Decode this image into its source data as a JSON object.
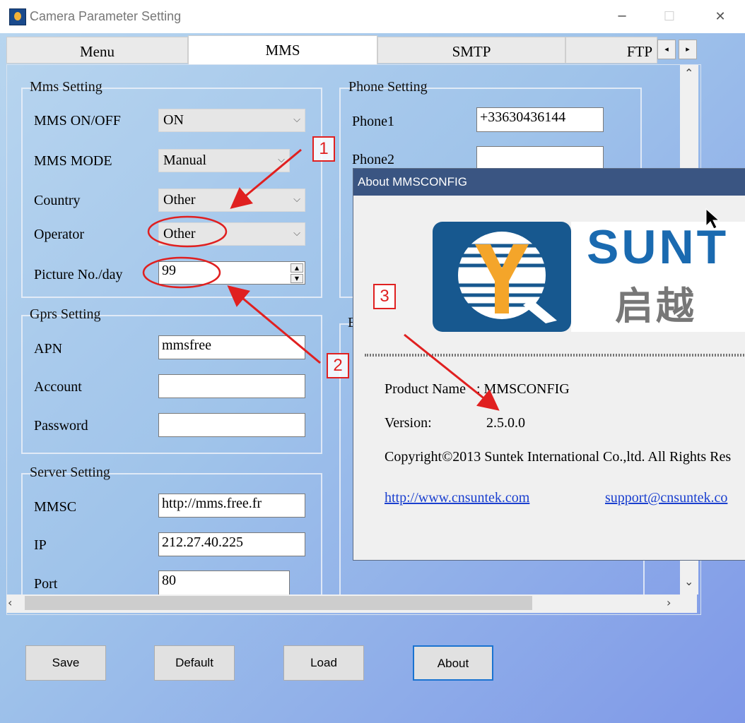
{
  "window": {
    "title": "Camera Parameter Setting",
    "controls": {
      "minimize": "─",
      "maximize": "☐",
      "close": "✕"
    }
  },
  "tabs": [
    {
      "label": "Menu"
    },
    {
      "label": "MMS"
    },
    {
      "label": "SMTP"
    },
    {
      "label": "FTP"
    }
  ],
  "tab_scroll": {
    "left": "◂",
    "right": "▸"
  },
  "mms_setting": {
    "title": "Mms Setting",
    "mms_onoff": {
      "label": "MMS ON/OFF",
      "value": "ON"
    },
    "mms_mode": {
      "label": "MMS MODE",
      "value": "Manual"
    },
    "country": {
      "label": "Country",
      "value": "Other"
    },
    "operator": {
      "label": "Operator",
      "value": "Other"
    },
    "picture_no": {
      "label": "Picture No./day",
      "value": "99"
    }
  },
  "gprs_setting": {
    "title": "Gprs Setting",
    "apn": {
      "label": "APN",
      "value": "mmsfree"
    },
    "account": {
      "label": "Account",
      "value": ""
    },
    "password": {
      "label": "Password",
      "value": ""
    }
  },
  "server_setting": {
    "title": "Server Setting",
    "mmsc": {
      "label": "MMSC",
      "value": "http://mms.free.fr"
    },
    "ip": {
      "label": "IP",
      "value": "212.27.40.225"
    },
    "port": {
      "label": "Port",
      "value": "80"
    }
  },
  "phone_setting": {
    "title": "Phone Setting",
    "phone1": {
      "label": "Phone1",
      "value": "+33630436144"
    },
    "phone2": {
      "label": "Phone2",
      "value": ""
    },
    "next_group_initial": "E"
  },
  "buttons": {
    "save": "Save",
    "default": "Default",
    "load": "Load",
    "about": "About"
  },
  "about_dialog": {
    "title": "About MMSCONFIG",
    "logo_text": "SUNT",
    "logo_chinese": "启越",
    "product_label": "Product Name",
    "product_name": ": MMSCONFIG",
    "version_label": "Version:",
    "version_value": "2.5.0.0",
    "copyright": "Copyright©2013  Suntek International Co.,ltd.  All Rights Res",
    "website": "http://www.cnsuntek.com",
    "email": "support@cnsuntek.co"
  },
  "annotations": [
    {
      "label": "1",
      "color": "#e02020"
    },
    {
      "label": "2",
      "color": "#e02020"
    },
    {
      "label": "3",
      "color": "#e02020"
    }
  ]
}
